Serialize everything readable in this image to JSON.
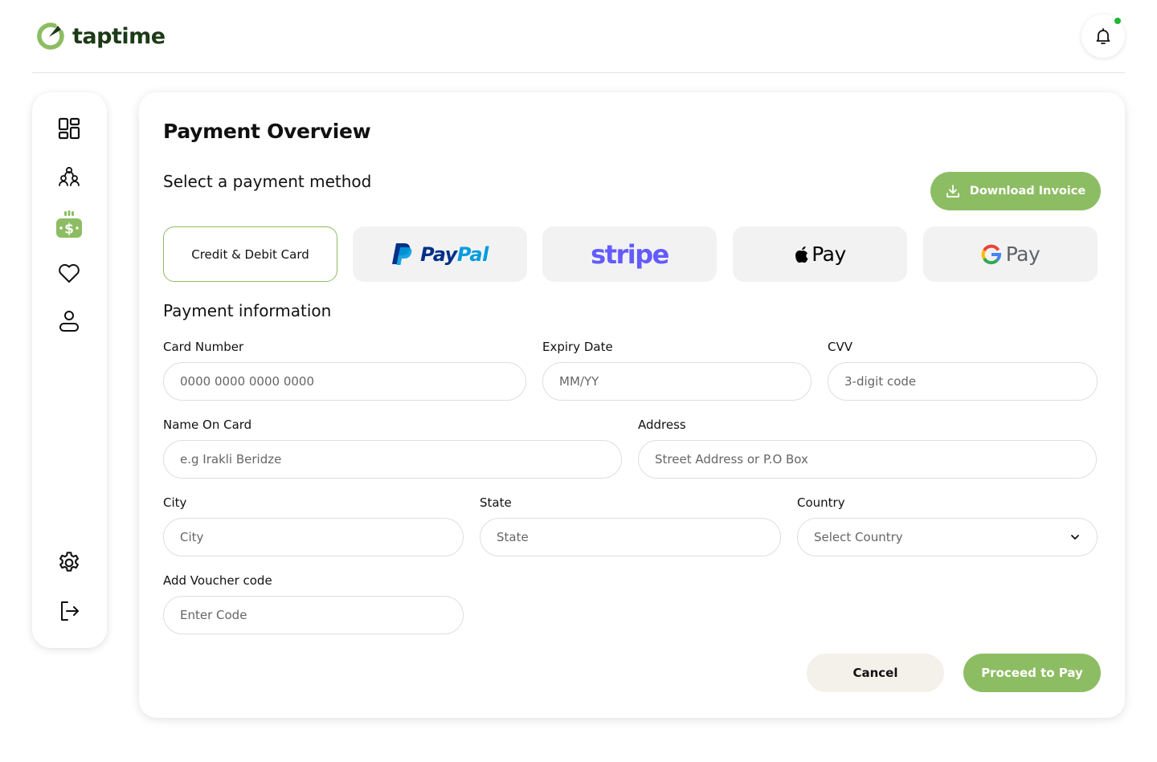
{
  "app": {
    "name": "taptime"
  },
  "colors": {
    "brand_green": "#8dbd63",
    "brand_dark": "#1c3a17",
    "notification_dot": "#1fb634",
    "paypal_dark": "#003087",
    "paypal_light": "#009cde",
    "stripe": "#635bff",
    "cancel_bg": "#f4f1ea",
    "method_bg": "#f2f2f2"
  },
  "header": {
    "notification_icon": "bell-icon"
  },
  "sidebar": {
    "items": [
      {
        "name": "dashboard",
        "icon": "dashboard-grid-icon",
        "active": false
      },
      {
        "name": "team",
        "icon": "users-group-icon",
        "active": false
      },
      {
        "name": "payments",
        "icon": "money-icon",
        "active": true
      },
      {
        "name": "favorites",
        "icon": "heart-icon",
        "active": false
      },
      {
        "name": "profile",
        "icon": "user-icon",
        "active": false
      },
      {
        "name": "settings",
        "icon": "gear-icon",
        "active": false
      },
      {
        "name": "logout",
        "icon": "logout-icon",
        "active": false
      }
    ]
  },
  "main": {
    "title": "Payment Overview",
    "method_heading": "Select a payment method",
    "download_label": "Download Invoice",
    "methods": [
      {
        "label": "Credit & Debit Card",
        "selected": true
      },
      {
        "label": "PayPal",
        "selected": false
      },
      {
        "label": "stripe",
        "selected": false
      },
      {
        "label": "Pay",
        "selected": false
      },
      {
        "label": "Pay",
        "selected": false
      }
    ],
    "info_heading": "Payment information",
    "fields": {
      "card_number": {
        "label": "Card Number",
        "placeholder": "0000 0000 0000 0000"
      },
      "expiry": {
        "label": "Expiry Date",
        "placeholder": "MM/YY"
      },
      "cvv": {
        "label": "CVV",
        "placeholder": "3-digit code"
      },
      "name": {
        "label": "Name On Card",
        "placeholder": "e.g Irakli Beridze"
      },
      "address": {
        "label": "Address",
        "placeholder": "Street Address or P.O Box"
      },
      "city": {
        "label": "City",
        "placeholder": "City"
      },
      "state": {
        "label": "State",
        "placeholder": "State"
      },
      "country": {
        "label": "Country",
        "value": "Select Country"
      },
      "voucher": {
        "label": "Add Voucher code",
        "placeholder": "Enter Code"
      }
    },
    "cancel_label": "Cancel",
    "proceed_label": "Proceed to Pay"
  }
}
